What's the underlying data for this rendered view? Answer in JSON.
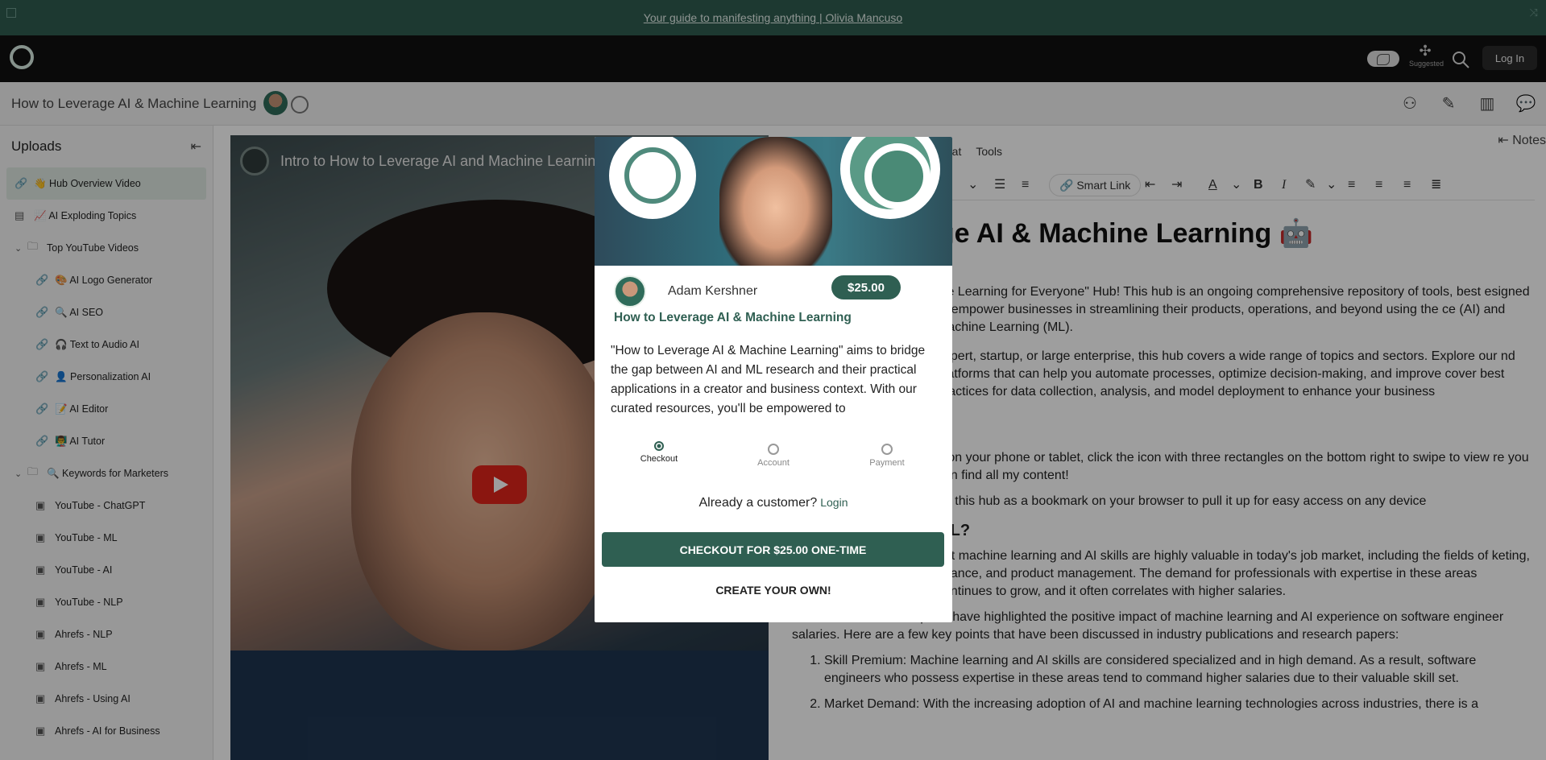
{
  "banner": {
    "link": "Your guide to manifesting anything | Olivia Mancuso"
  },
  "appbar": {
    "suggested_label": "Suggested",
    "login_label": "Log In"
  },
  "titlebar": {
    "title": "How to Leverage AI & Machine Learning"
  },
  "sidebar": {
    "title": "Uploads",
    "items": [
      {
        "label": "👋 Hub Overview Video"
      },
      {
        "label": "📈 AI Exploding Topics"
      },
      {
        "label": "Top YouTube Videos"
      },
      {
        "label": "🎨 AI Logo Generator"
      },
      {
        "label": "🔍 AI SEO"
      },
      {
        "label": "🎧 Text to Audio AI"
      },
      {
        "label": "👤 Personalization AI"
      },
      {
        "label": "📝 AI Editor"
      },
      {
        "label": "👨‍🏫 AI Tutor"
      },
      {
        "label": "🔍 Keywords for Marketers"
      },
      {
        "label": "YouTube - ChatGPT"
      },
      {
        "label": "YouTube - ML"
      },
      {
        "label": "YouTube - AI"
      },
      {
        "label": "YouTube - NLP"
      },
      {
        "label": "Ahrefs - NLP"
      },
      {
        "label": "Ahrefs - ML"
      },
      {
        "label": "Ahrefs - Using AI"
      },
      {
        "label": "Ahrefs - AI for Business"
      }
    ]
  },
  "video": {
    "title": "Intro to How to Leverage AI and Machine Learning"
  },
  "editor": {
    "menu": [
      "mat",
      "Tools"
    ],
    "smart_link": "Smart Link",
    "notes": "Notes",
    "heading": "age AI & Machine Learning 🤖",
    "p1": "ine Learning for Everyone\" Hub! This hub is an ongoing comprehensive repository of tools, best esigned to empower businesses in streamlining their products, operations, and beyond using the ce (AI) and Machine Learning (ML).",
    "p2": "expert, startup, or large enterprise, this hub covers a wide range of topics and sectors. Explore our nd platforms that can help you automate processes, optimize decision-making, and improve cover best practices for data collection, analysis, and model deployment to enhance your business",
    "p3": "e on your phone or tablet, click the icon with three rectangles on the bottom right to swipe to view re you can find all my content!",
    "p4": "dd this hub as a bookmark on your browser to pull it up for easy access on any device",
    "h2": "ML?",
    "p5": "hat machine learning and AI skills are highly valuable in today's job market, including the fields of keting, finance, and product management. The demand for professionals with expertise in these areas continues to grow, and it often correlates with higher salaries.",
    "p6": "Several studies and reports have highlighted the positive impact of machine learning and AI experience on software engineer salaries. Here are a few key points that have been discussed in industry publications and research papers:",
    "li1": "Skill Premium: Machine learning and AI skills are considered specialized and in high demand. As a result, software engineers who possess expertise in these areas tend to command higher salaries due to their valuable skill set.",
    "li2": "Market Demand: With the increasing adoption of AI and machine learning technologies across industries, there is a"
  },
  "modal": {
    "author": "Adam Kershner",
    "price": "$25.00",
    "title": "How to Leverage AI & Machine Learning",
    "description": "\"How to Leverage AI & Machine Learning\" aims to bridge the gap between AI and ML research and their practical applications in a creator and business context. With our curated resources, you'll be empowered to",
    "steps": [
      "Checkout",
      "Account",
      "Payment"
    ],
    "already_customer": "Already a customer?",
    "login_link": "Login",
    "checkout_button": "CHECKOUT FOR $25.00 ONE-TIME",
    "create_button": "CREATE YOUR OWN!"
  },
  "colors": {
    "brand": "#2f5f52",
    "banner": "#2f5c50"
  }
}
